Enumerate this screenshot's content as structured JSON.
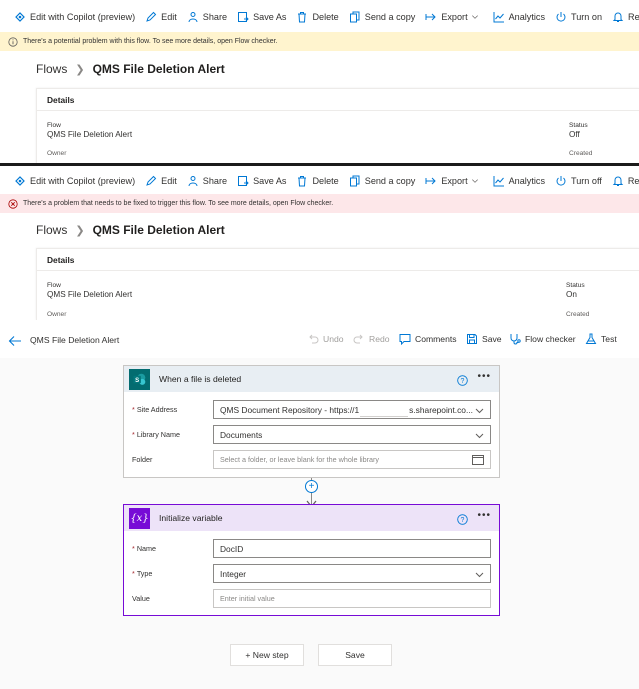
{
  "toolbar_on": {
    "edit_copilot": "Edit with Copilot (preview)",
    "edit": "Edit",
    "share": "Share",
    "save_as": "Save As",
    "delete": "Delete",
    "send_copy": "Send a copy",
    "export": "Export",
    "analytics": "Analytics",
    "turn": "Turn on",
    "repair": "Repair tips off"
  },
  "toolbar_off": {
    "edit_copilot": "Edit with Copilot (preview)",
    "edit": "Edit",
    "share": "Share",
    "save_as": "Save As",
    "delete": "Delete",
    "send_copy": "Send a copy",
    "export": "Export",
    "analytics": "Analytics",
    "turn": "Turn off",
    "repair": "Repair tips off"
  },
  "panel1": {
    "banner": "There's a potential problem with this flow. To see more details, open Flow checker.",
    "breadcrumb": {
      "root": "Flows",
      "current": "QMS File Deletion Alert"
    },
    "details": {
      "heading": "Details",
      "flow_label": "Flow",
      "flow_value": "QMS File Deletion Alert",
      "status_label": "Status",
      "status_value": "Off",
      "owner_label": "Owner",
      "created_label": "Created"
    }
  },
  "panel2": {
    "banner": "There's a problem that needs to be fixed to trigger this flow. To see more details, open Flow checker.",
    "breadcrumb": {
      "root": "Flows",
      "current": "QMS File Deletion Alert"
    },
    "details": {
      "heading": "Details",
      "flow_label": "Flow",
      "flow_value": "QMS File Deletion Alert",
      "status_label": "Status",
      "status_value": "On",
      "owner_label": "Owner",
      "created_label": "Created"
    }
  },
  "designer": {
    "title": "QMS File Deletion Alert",
    "undo": "Undo",
    "redo": "Redo",
    "comments": "Comments",
    "save": "Save",
    "flow_checker": "Flow checker",
    "test": "Test",
    "trigger": {
      "title": "When a file is deleted",
      "site_address_label": "Site Address",
      "site_address_value_left": "QMS Document Repository - https://1",
      "site_address_value_right": "s.sharepoint.co...",
      "library_name_label": "Library Name",
      "library_name_value": "Documents",
      "folder_label": "Folder",
      "folder_placeholder": "Select a folder, or leave blank for the whole library"
    },
    "init_var": {
      "title": "Initialize variable",
      "name_label": "Name",
      "name_value": "DocID",
      "type_label": "Type",
      "type_value": "Integer",
      "value_label": "Value",
      "value_placeholder": "Enter initial value"
    },
    "new_step": "+ New step",
    "save_button": "Save"
  },
  "colors": {
    "warning_bg": "#fff4ce",
    "error_bg": "#fde7e9",
    "accent": "#0078d4",
    "sharepoint": "#036c70",
    "variable": "#770bd6"
  }
}
